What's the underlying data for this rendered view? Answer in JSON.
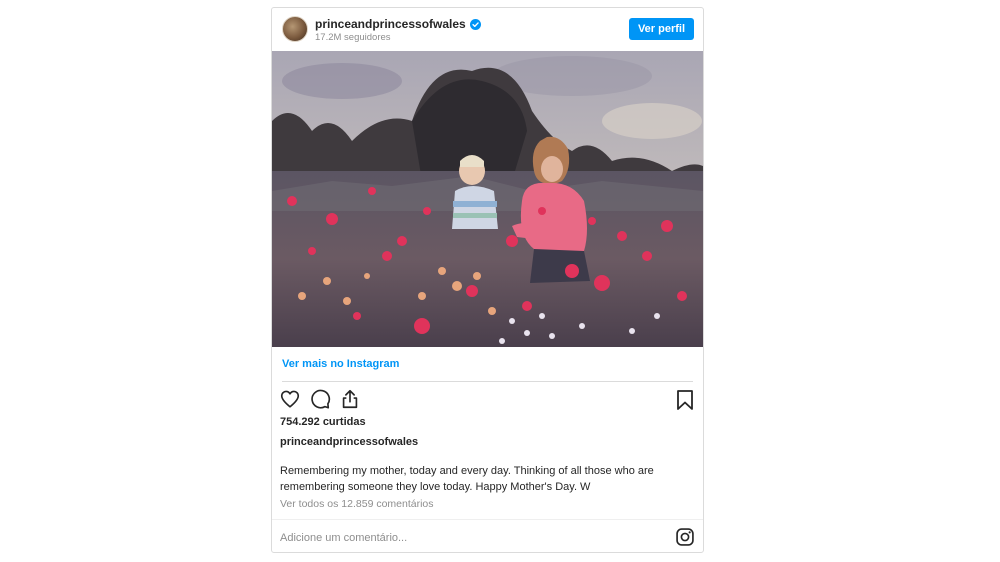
{
  "post": {
    "username": "princeandprincessofwales",
    "followers": "17.2M seguidores",
    "view_profile_label": "Ver perfil",
    "view_more_label": "Ver mais no Instagram",
    "likes": "754.292 curtidas",
    "caption": "Remembering my mother, today and every day. Thinking of all those who are remembering someone they love today. Happy Mother's Day. W",
    "view_all_comments": "Ver todos os 12.859 comentários",
    "comment_placeholder": "Adicione um comentário..."
  },
  "icons": {
    "verified": "verified-badge-icon",
    "like": "heart-icon",
    "comment": "comment-bubble-icon",
    "share": "share-upload-icon",
    "save": "bookmark-icon",
    "brand": "instagram-icon"
  },
  "colors": {
    "accent": "#0095f6",
    "text": "#262626",
    "muted": "#8e8e8e",
    "border": "#dbdbdb"
  }
}
